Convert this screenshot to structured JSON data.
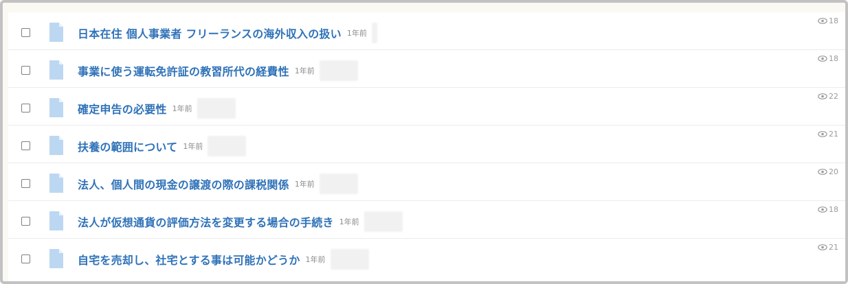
{
  "list": {
    "items": [
      {
        "title": "日本在住 個人事業者 フリーランスの海外収入の扱い",
        "age": "1年前",
        "views": "18"
      },
      {
        "title": "事業に使う運転免許証の教習所代の経費性",
        "age": "1年前",
        "views": "18"
      },
      {
        "title": "確定申告の必要性",
        "age": "1年前",
        "views": "22"
      },
      {
        "title": "扶養の範囲について",
        "age": "1年前",
        "views": "21"
      },
      {
        "title": "法人、個人間の現金の譲渡の際の課税関係",
        "age": "1年前",
        "views": "20"
      },
      {
        "title": "法人が仮想通貨の評価方法を変更する場合の手続き",
        "age": "1年前",
        "views": "18"
      },
      {
        "title": "自宅を売却し、社宅とする事は可能かどうか",
        "age": "1年前",
        "views": "21"
      }
    ]
  },
  "colors": {
    "title": "#2f72b8",
    "doc_icon": "#bcd7f1",
    "meta": "#8c8c8c"
  },
  "icons": {
    "row_icon": "document-icon",
    "views_icon": "eye-icon"
  }
}
